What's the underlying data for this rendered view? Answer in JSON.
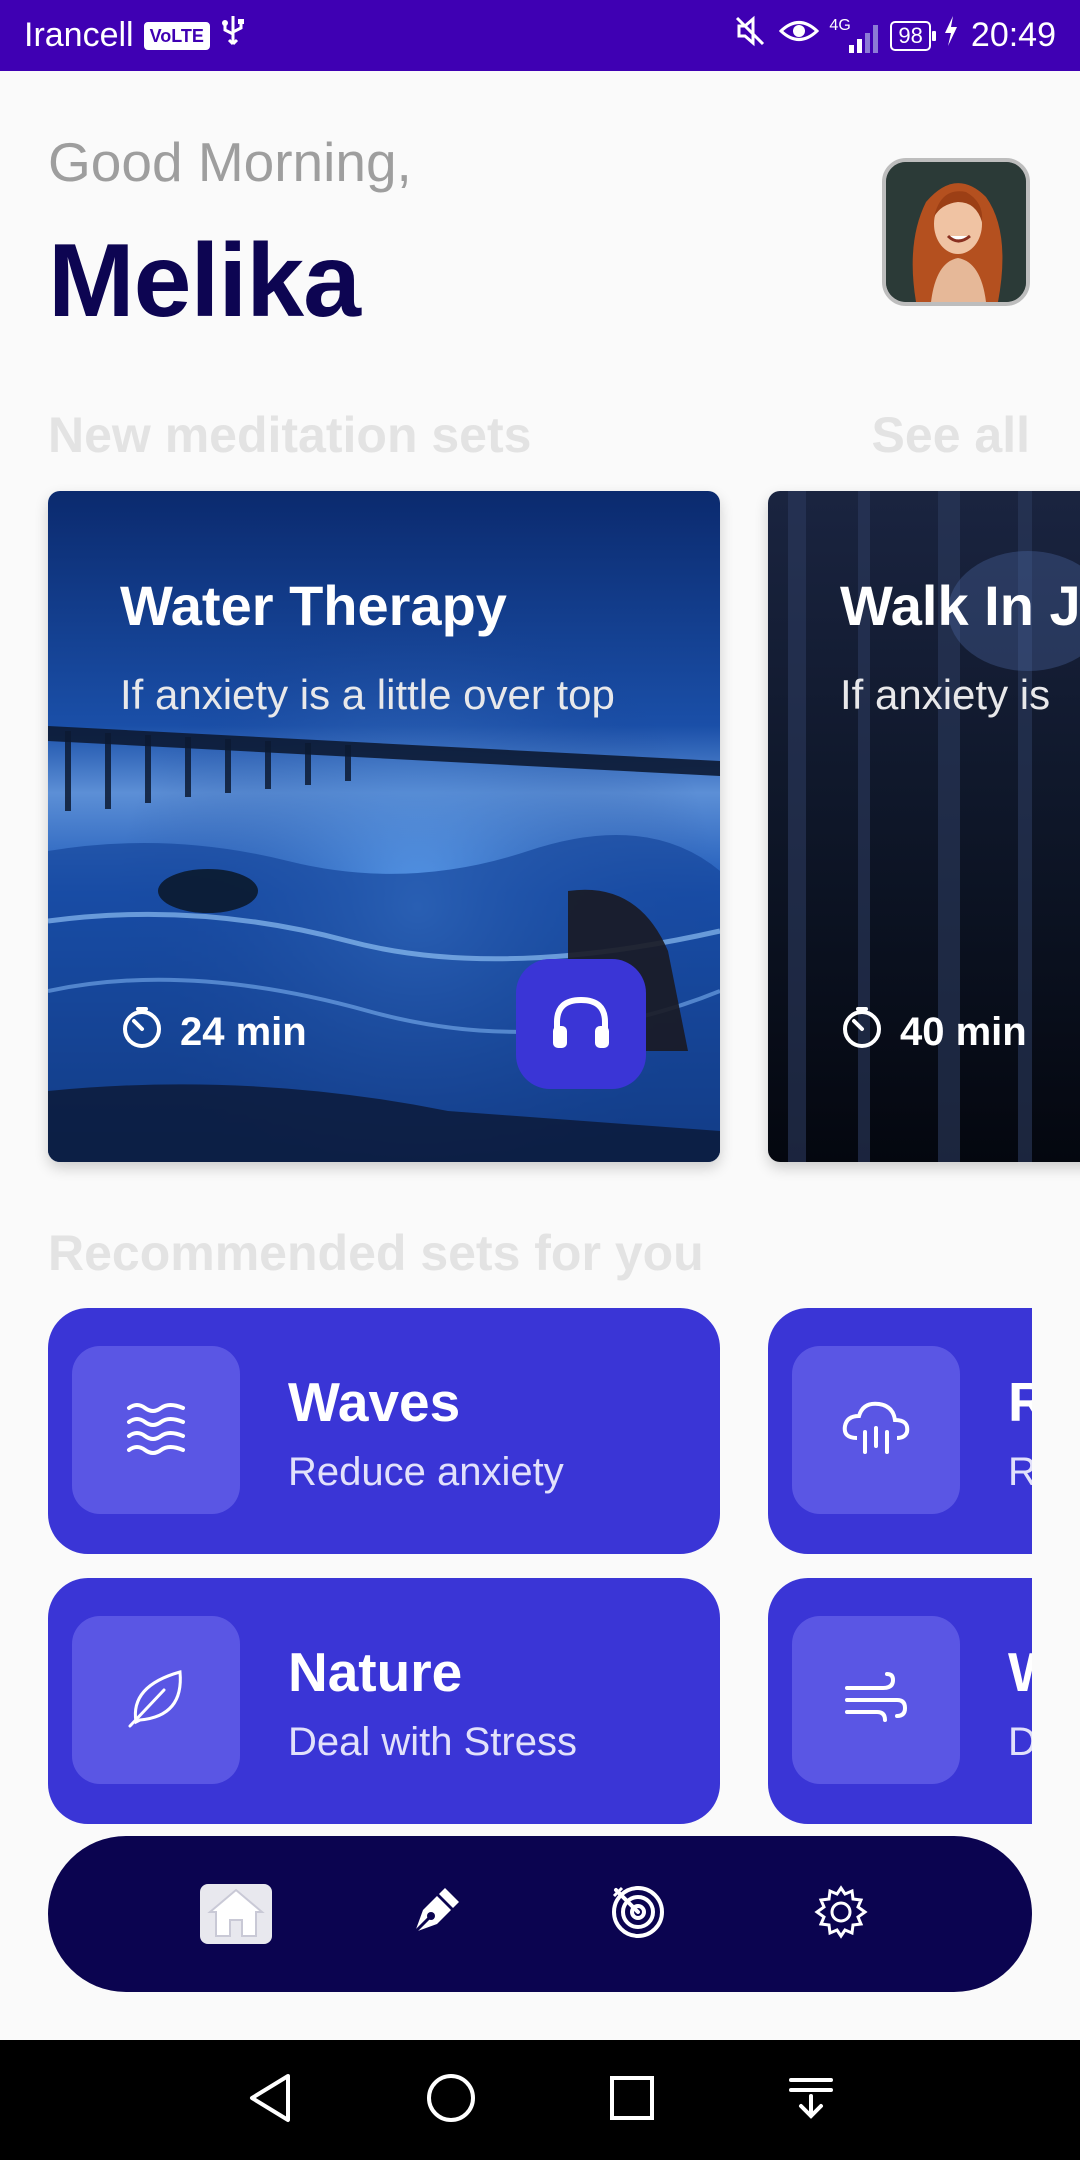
{
  "status_bar": {
    "carrier": "Irancell",
    "volte": "VoLTE",
    "network": "4G",
    "battery": "98",
    "time": "20:49"
  },
  "header": {
    "greeting": "Good Morning,",
    "user_name": "Melika"
  },
  "meditation_section": {
    "title": "New meditation sets",
    "see_all": "See all",
    "cards": [
      {
        "title": "Water Therapy",
        "subtitle": "If anxiety is a little over top",
        "duration": "24 min"
      },
      {
        "title": "Walk In J",
        "subtitle": "If anxiety is",
        "duration": "40 min"
      }
    ]
  },
  "recommended_section": {
    "title": "Recommended sets for you",
    "cards": [
      {
        "title": "Waves",
        "subtitle": "Reduce anxiety",
        "icon": "waves-icon"
      },
      {
        "title": "R",
        "subtitle": "R",
        "icon": "cloud-rain-icon"
      },
      {
        "title": "Nature",
        "subtitle": "Deal with Stress",
        "icon": "leaf-icon"
      },
      {
        "title": "W",
        "subtitle": "D",
        "icon": "wind-icon"
      }
    ]
  },
  "bottom_nav": {
    "items": [
      "home-icon",
      "pen-icon",
      "target-icon",
      "gear-icon"
    ],
    "active": "home-icon"
  },
  "colors": {
    "status_bar": "#3f00b3",
    "accent": "#3a35d6",
    "nav_background": "#0b0450",
    "name_text": "#0d0552"
  }
}
